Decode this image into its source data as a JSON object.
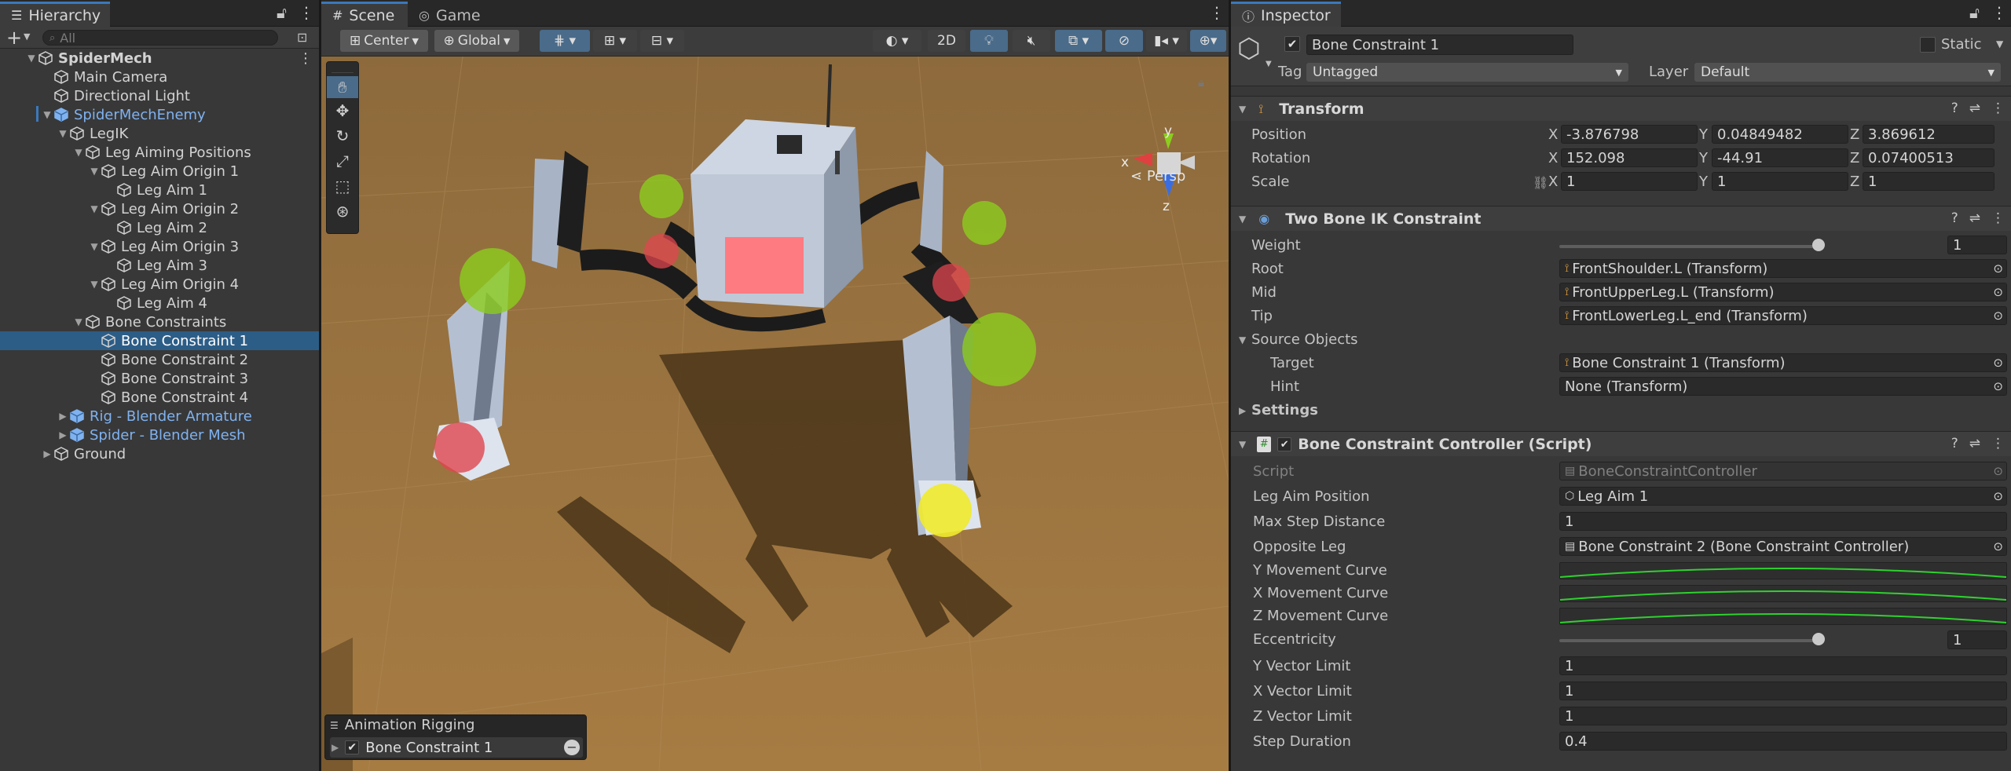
{
  "hierarchy": {
    "tab_label": "Hierarchy",
    "search_placeholder": "All",
    "items": [
      {
        "label": "SpiderMech",
        "depth": 0,
        "expanded": true,
        "style": "bold"
      },
      {
        "label": "Main Camera",
        "depth": 1
      },
      {
        "label": "Directional Light",
        "depth": 1
      },
      {
        "label": "SpiderMechEnemy",
        "depth": 1,
        "expanded": true,
        "style": "blue"
      },
      {
        "label": "LegIK",
        "depth": 2,
        "expanded": true
      },
      {
        "label": "Leg Aiming Positions",
        "depth": 3,
        "expanded": true
      },
      {
        "label": "Leg Aim Origin 1",
        "depth": 4,
        "expanded": true
      },
      {
        "label": "Leg Aim 1",
        "depth": 5
      },
      {
        "label": "Leg Aim Origin 2",
        "depth": 4,
        "expanded": true
      },
      {
        "label": "Leg Aim 2",
        "depth": 5
      },
      {
        "label": "Leg Aim Origin 3",
        "depth": 4,
        "expanded": true
      },
      {
        "label": "Leg Aim 3",
        "depth": 5
      },
      {
        "label": "Leg Aim Origin 4",
        "depth": 4,
        "expanded": true
      },
      {
        "label": "Leg Aim 4",
        "depth": 5
      },
      {
        "label": "Bone Constraints",
        "depth": 3,
        "expanded": true
      },
      {
        "label": "Bone Constraint 1",
        "depth": 4,
        "selected": true
      },
      {
        "label": "Bone Constraint 2",
        "depth": 4
      },
      {
        "label": "Bone Constraint 3",
        "depth": 4
      },
      {
        "label": "Bone Constraint 4",
        "depth": 4
      },
      {
        "label": "Rig - Blender Armature",
        "depth": 2,
        "collapsed": true,
        "style": "blue"
      },
      {
        "label": "Spider - Blender Mesh",
        "depth": 2,
        "collapsed": true,
        "style": "blue"
      },
      {
        "label": "Ground",
        "depth": 1,
        "collapsed": true
      }
    ]
  },
  "scene": {
    "tab_scene": "Scene",
    "tab_game": "Game",
    "pivot_label": "Center",
    "space_label": "Global",
    "mode_2d": "2D",
    "gizmo_y": "y",
    "gizmo_x": "x",
    "gizmo_z": "z",
    "persp_label": "Persp",
    "overlay_title": "Animation Rigging",
    "overlay_item": "Bone Constraint 1"
  },
  "inspector": {
    "tab_label": "Inspector",
    "object_name": "Bone Constraint 1",
    "static_label": "Static",
    "tag_label": "Tag",
    "tag_value": "Untagged",
    "layer_label": "Layer",
    "layer_value": "Default",
    "transform": {
      "title": "Transform",
      "position_label": "Position",
      "rotation_label": "Rotation",
      "scale_label": "Scale",
      "axis_x": "X",
      "axis_y": "Y",
      "axis_z": "Z",
      "position": [
        "-3.876798",
        "0.04849482",
        "3.869612"
      ],
      "rotation": [
        "152.098",
        "-44.91",
        "0.07400513"
      ],
      "scale": [
        "1",
        "1",
        "1"
      ]
    },
    "two_bone": {
      "title": "Two Bone IK Constraint",
      "weight_label": "Weight",
      "weight_value": "1",
      "root_label": "Root",
      "root_value": "FrontShoulder.L (Transform)",
      "mid_label": "Mid",
      "mid_value": "FrontUpperLeg.L (Transform)",
      "tip_label": "Tip",
      "tip_value": "FrontLowerLeg.L_end (Transform)",
      "source_label": "Source Objects",
      "target_label": "Target",
      "target_value": "Bone Constraint 1 (Transform)",
      "hint_label": "Hint",
      "hint_value": "None (Transform)",
      "settings_label": "Settings"
    },
    "controller": {
      "title": "Bone Constraint Controller (Script)",
      "script_label": "Script",
      "script_value": "BoneConstraintController",
      "leg_aim_label": "Leg Aim Position",
      "leg_aim_value": "Leg Aim 1",
      "max_step_label": "Max Step Distance",
      "max_step_value": "1",
      "opposite_label": "Opposite Leg",
      "opposite_value": "Bone Constraint 2 (Bone Constraint Controller)",
      "ymove_label": "Y Movement Curve",
      "xmove_label": "X Movement Curve",
      "zmove_label": "Z Movement Curve",
      "ecc_label": "Eccentricity",
      "ecc_value": "1",
      "yvec_label": "Y Vector Limit",
      "yvec_value": "1",
      "xvec_label": "X Vector Limit",
      "xvec_value": "1",
      "zvec_label": "Z Vector Limit",
      "zvec_value": "1",
      "step_dur_label": "Step Duration",
      "step_dur_value": "0.4"
    }
  },
  "colors": {
    "accent": "#3a79bb",
    "selection": "#2c5d87",
    "ground": "#9a7440",
    "target_red": "#e0464f",
    "target_green": "#8ccd1e",
    "target_yellow": "#f0ea2c",
    "curve_green": "#2fd12f"
  }
}
